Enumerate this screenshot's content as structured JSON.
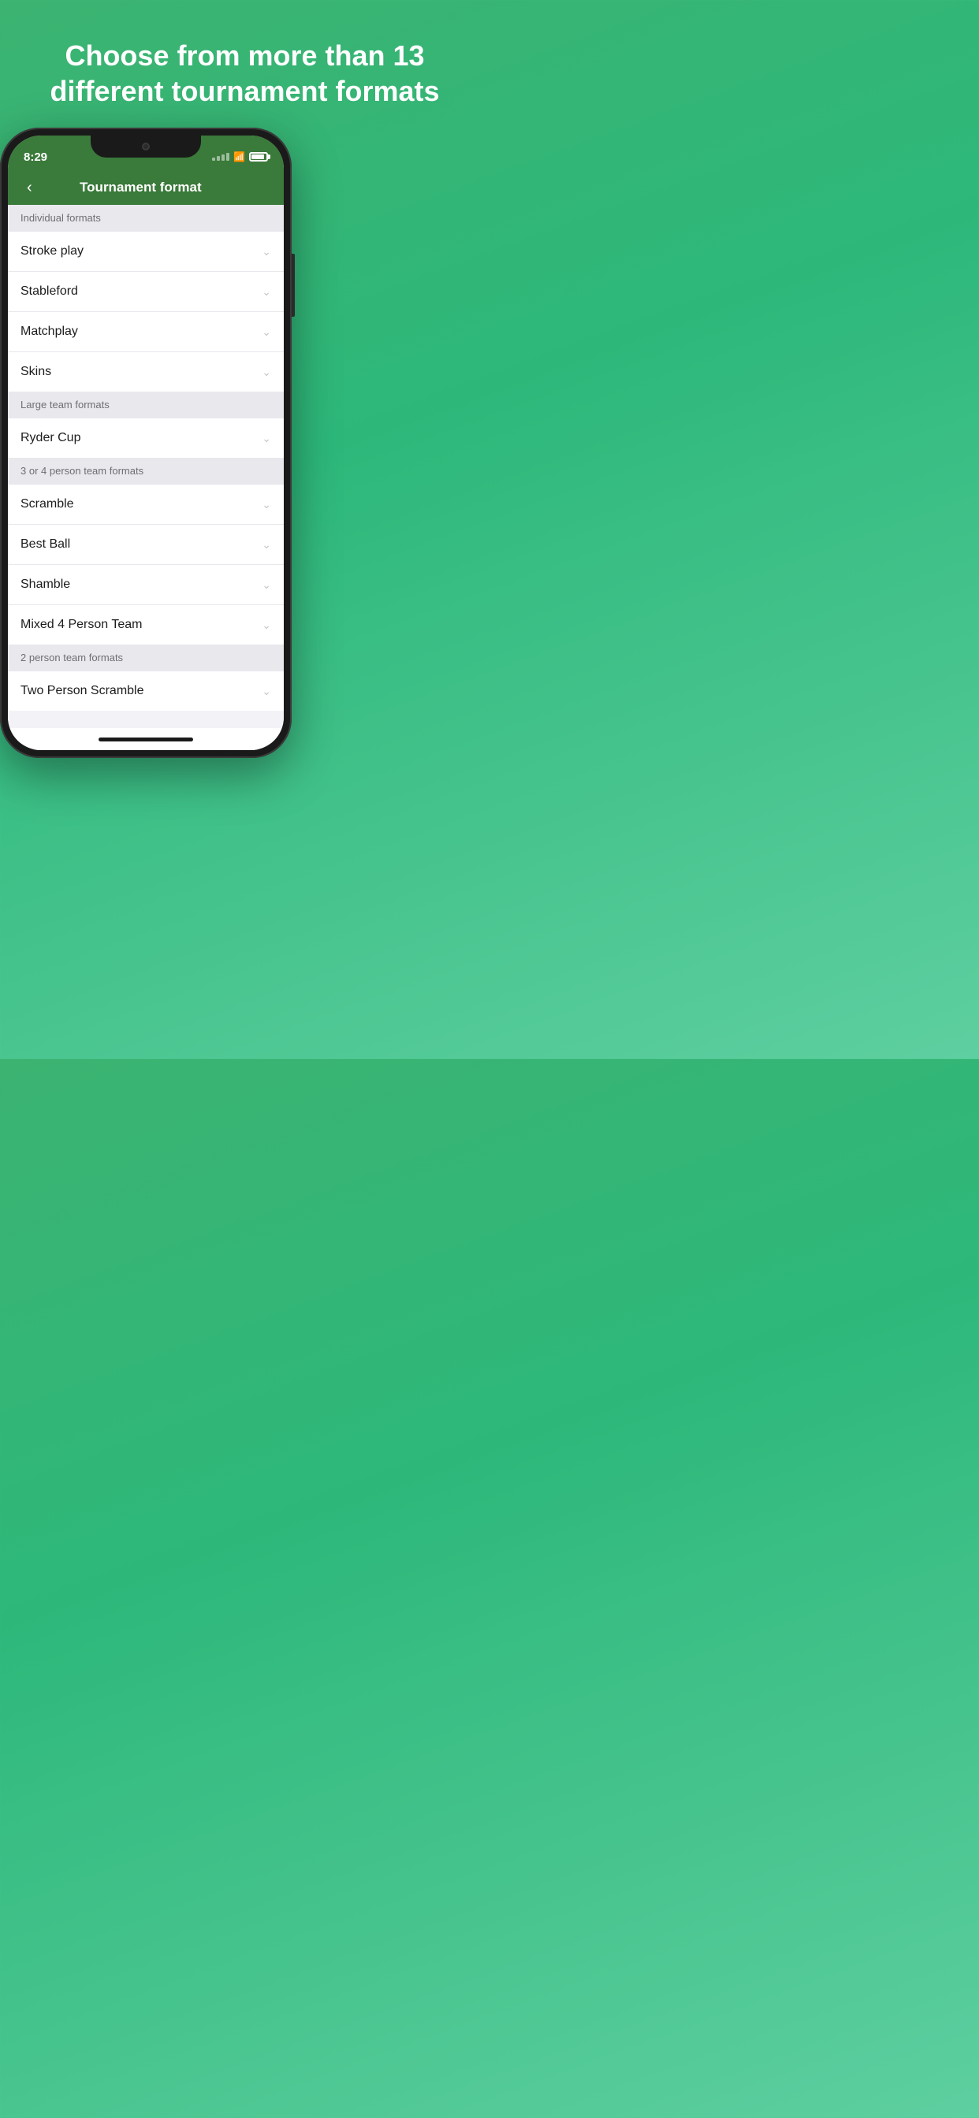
{
  "page": {
    "background_title": "Choose from more than 13 different tournament formats",
    "app": {
      "status_bar": {
        "time": "8:29"
      },
      "nav": {
        "back_icon": "chevron-left",
        "title": "Tournament format"
      },
      "sections": [
        {
          "id": "individual",
          "label": "Individual formats",
          "items": [
            {
              "id": "stroke-play",
              "label": "Stroke play"
            },
            {
              "id": "stableford",
              "label": "Stableford"
            },
            {
              "id": "matchplay",
              "label": "Matchplay"
            },
            {
              "id": "skins",
              "label": "Skins"
            }
          ]
        },
        {
          "id": "large-team",
          "label": "Large team formats",
          "items": [
            {
              "id": "ryder-cup",
              "label": "Ryder Cup"
            }
          ]
        },
        {
          "id": "3or4-person",
          "label": "3 or 4 person team formats",
          "items": [
            {
              "id": "scramble",
              "label": "Scramble"
            },
            {
              "id": "best-ball",
              "label": "Best Ball"
            },
            {
              "id": "shamble",
              "label": "Shamble"
            },
            {
              "id": "mixed-4-person",
              "label": "Mixed 4 Person Team"
            }
          ]
        },
        {
          "id": "2-person",
          "label": "2 person team formats",
          "items": [
            {
              "id": "two-person-scramble",
              "label": "Two Person Scramble"
            }
          ]
        }
      ]
    }
  }
}
